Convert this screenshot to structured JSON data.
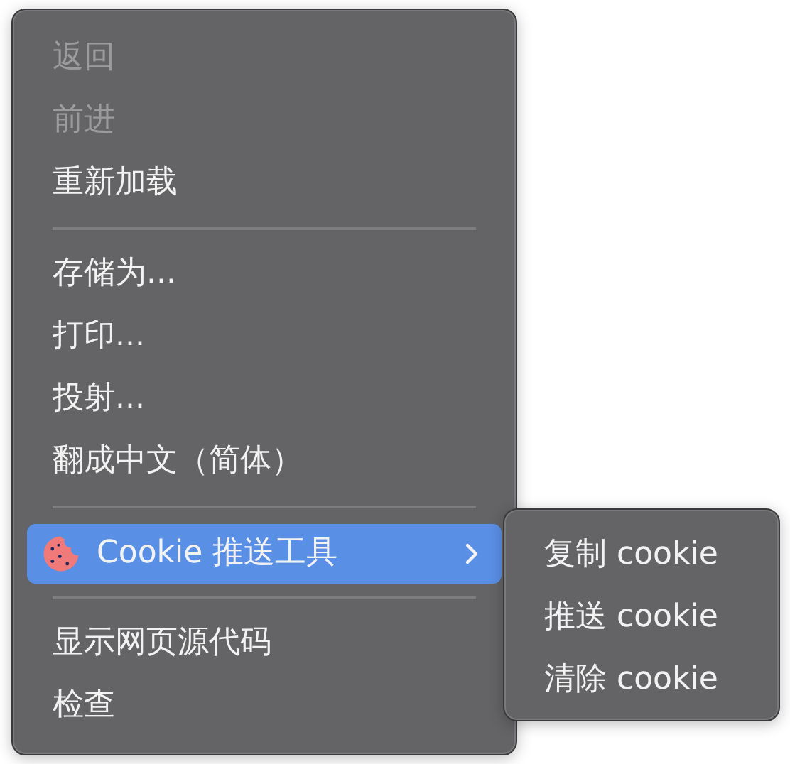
{
  "menu": {
    "items": [
      {
        "kind": "item",
        "label": "返回",
        "disabled": true
      },
      {
        "kind": "item",
        "label": "前进",
        "disabled": true
      },
      {
        "kind": "item",
        "label": "重新加载",
        "disabled": false
      },
      {
        "kind": "separator"
      },
      {
        "kind": "item",
        "label": "存储为...",
        "disabled": false
      },
      {
        "kind": "item",
        "label": "打印...",
        "disabled": false
      },
      {
        "kind": "item",
        "label": "投射...",
        "disabled": false
      },
      {
        "kind": "item",
        "label": "翻成中文（简体）",
        "disabled": false
      },
      {
        "kind": "separator"
      },
      {
        "kind": "submenu",
        "label": "Cookie 推送工具",
        "selected": true,
        "items": [
          {
            "label": "复制 cookie"
          },
          {
            "label": "推送 cookie"
          },
          {
            "label": "清除 cookie"
          }
        ]
      },
      {
        "kind": "separator"
      },
      {
        "kind": "item",
        "label": "显示网页源代码",
        "disabled": false
      },
      {
        "kind": "item",
        "label": "检查",
        "disabled": false
      }
    ]
  }
}
